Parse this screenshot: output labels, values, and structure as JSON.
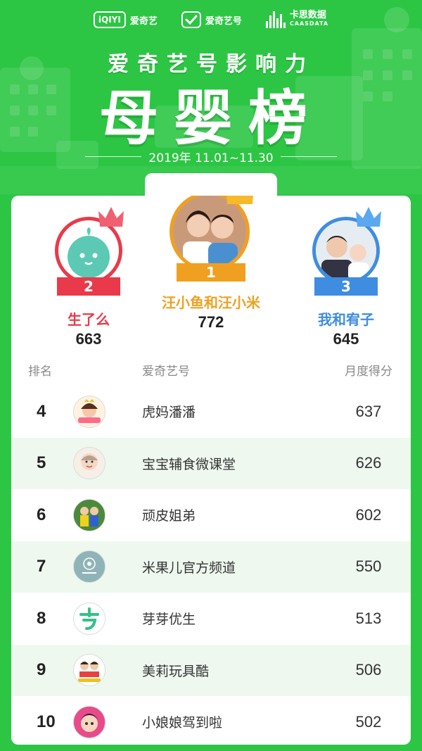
{
  "header": {
    "logos": [
      {
        "mark": "iQIYI",
        "label": "爱奇艺"
      },
      {
        "label": "爱奇艺号"
      },
      {
        "label": "卡思数据",
        "sub": "CAASDATA"
      }
    ],
    "subtitle": "爱奇艺号影响力",
    "title": "母婴榜",
    "date_range": "2019年 11.01~11.30"
  },
  "podium": [
    {
      "rank": "2",
      "name": "生了么",
      "score": "663",
      "color": "#e83a4a",
      "crown_color": "#f06072"
    },
    {
      "rank": "1",
      "name": "汪小鱼和汪小米",
      "score": "772",
      "color": "#f0a020",
      "crown_color": "#f7b92a"
    },
    {
      "rank": "3",
      "name": "我和宥子",
      "score": "645",
      "color": "#3f8de0",
      "crown_color": "#5aa8f0"
    }
  ],
  "table": {
    "headers": {
      "rank": "排名",
      "name": "爱奇艺号",
      "score": "月度得分"
    },
    "rows": [
      {
        "rank": "4",
        "name": "虎妈潘潘",
        "score": "637"
      },
      {
        "rank": "5",
        "name": "宝宝辅食微课堂",
        "score": "626"
      },
      {
        "rank": "6",
        "name": "顽皮姐弟",
        "score": "602"
      },
      {
        "rank": "7",
        "name": "米果儿官方频道",
        "score": "550"
      },
      {
        "rank": "8",
        "name": "芽芽优生",
        "score": "513"
      },
      {
        "rank": "9",
        "name": "美莉玩具酷",
        "score": "506"
      },
      {
        "rank": "10",
        "name": "小娘娘驾到啦",
        "score": "502"
      }
    ]
  },
  "colors": {
    "brand_green": "#2cc644",
    "row_alt": "#eef8ef"
  }
}
